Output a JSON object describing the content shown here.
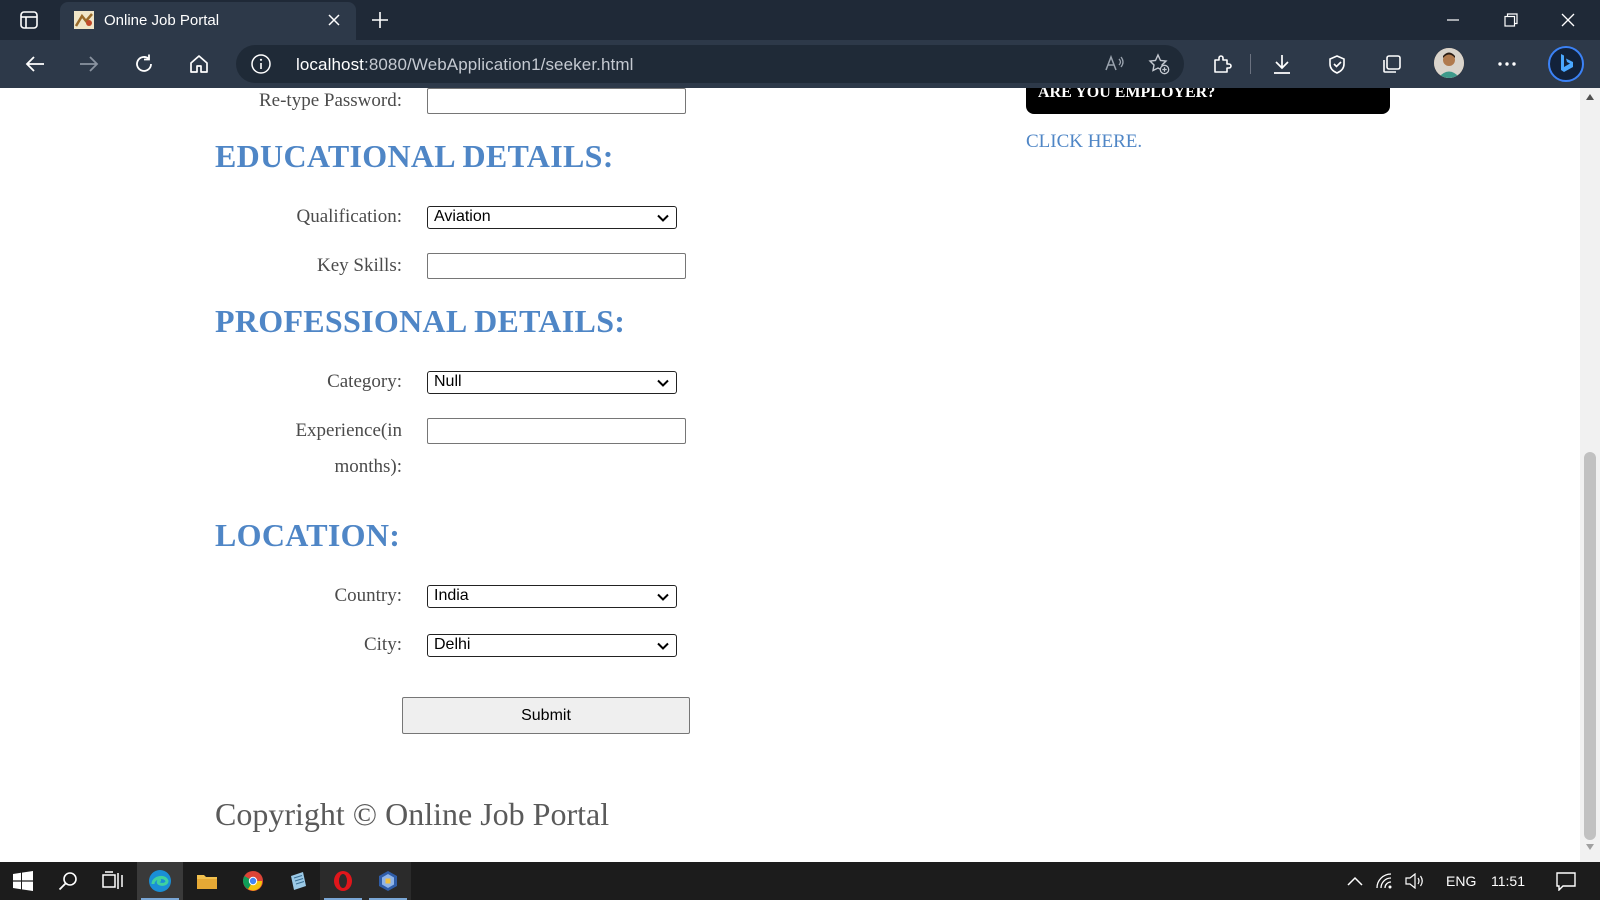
{
  "browser": {
    "tab_title": "Online Job Portal",
    "url_host": "localhost",
    "url_rest": ":8080/WebApplication1/seeker.html"
  },
  "page": {
    "retype_password_label": "Re-type Password:",
    "educational_heading": "EDUCATIONAL DETAILS:",
    "qualification_label": "Qualification:",
    "qualification_value": "Aviation",
    "key_skills_label": "Key Skills:",
    "professional_heading": "PROFESSIONAL DETAILS:",
    "category_label": "Category:",
    "category_value": "Null",
    "experience_label_line1": "Experience(in",
    "experience_label_line2": "months):",
    "location_heading": "LOCATION:",
    "country_label": "Country:",
    "country_value": "India",
    "city_label": "City:",
    "city_value": "Delhi",
    "submit_label": "Submit",
    "copyright": "Copyright © Online Job Portal",
    "employer_box_text": "ARE YOU EMPLOYER?",
    "click_here": "CLICK HERE."
  },
  "taskbar": {
    "language": "ENG",
    "time": "11:51"
  },
  "colors": {
    "heading": "#4f86c6",
    "chrome_dark": "#1f2937",
    "chrome_toolbar": "#2d3949"
  }
}
